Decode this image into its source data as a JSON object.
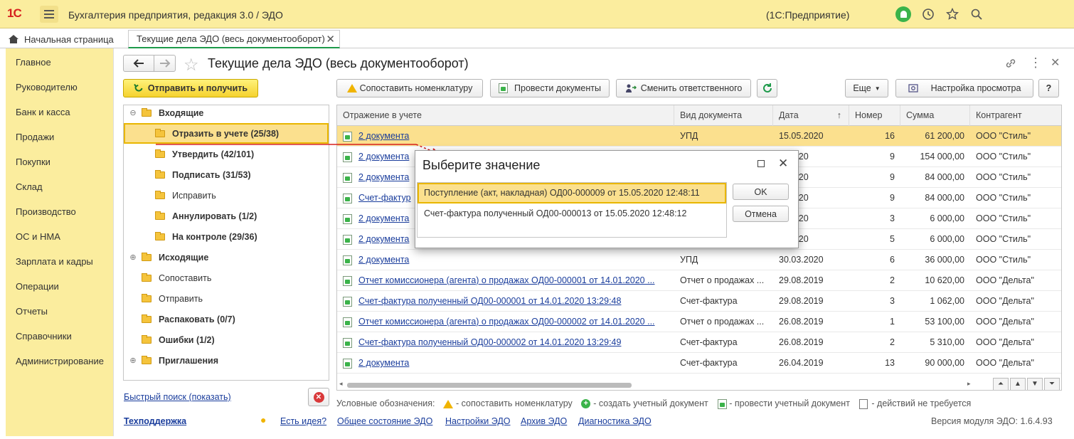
{
  "app": {
    "logo": "1С",
    "title": "Бухгалтерия предприятия, редакция 3.0 / ЭДО",
    "platform": "(1С:Предприятие)"
  },
  "tabs": {
    "home": "Начальная страница",
    "active": "Текущие дела ЭДО (весь документооборот)"
  },
  "sections": [
    "Главное",
    "Руководителю",
    "Банк и касса",
    "Продажи",
    "Покупки",
    "Склад",
    "Производство",
    "ОС и НМА",
    "Зарплата и кадры",
    "Операции",
    "Отчеты",
    "Справочники",
    "Администрирование"
  ],
  "page": {
    "title": "Текущие дела ЭДО (весь документооборот)",
    "send_receive": "Отправить и получить",
    "toolbar": {
      "match_nomenclature": "Сопоставить номенклатуру",
      "post_documents": "Провести документы",
      "change_responsible": "Сменить ответственного",
      "more": "Еще",
      "view_settings": "Настройка просмотра",
      "help": "?"
    }
  },
  "tree": [
    {
      "label": "Входящие",
      "bold": true,
      "level": 0,
      "expander": "⊖"
    },
    {
      "label": "Отразить в учете (25/38)",
      "bold": true,
      "level": 1,
      "selected": true
    },
    {
      "label": "Утвердить (42/101)",
      "bold": true,
      "level": 1
    },
    {
      "label": "Подписать (31/53)",
      "bold": true,
      "level": 1
    },
    {
      "label": "Исправить",
      "bold": false,
      "level": 1
    },
    {
      "label": "Аннулировать (1/2)",
      "bold": true,
      "level": 1
    },
    {
      "label": "На контроле (29/36)",
      "bold": true,
      "level": 1
    },
    {
      "label": "Исходящие",
      "bold": true,
      "level": 0,
      "expander": "⊕"
    },
    {
      "label": "Сопоставить",
      "bold": false,
      "level": 0
    },
    {
      "label": "Отправить",
      "bold": false,
      "level": 0
    },
    {
      "label": "Распаковать (0/7)",
      "bold": true,
      "level": 0
    },
    {
      "label": "Ошибки (1/2)",
      "bold": true,
      "level": 0
    },
    {
      "label": "Приглашения",
      "bold": true,
      "level": 0,
      "expander": "⊕"
    }
  ],
  "grid": {
    "columns": [
      "Отражение в учете",
      "Вид документа",
      "Дата",
      "Номер",
      "Сумма",
      "Контрагент"
    ],
    "sort_indicator": "↑",
    "rows": [
      {
        "doc": "2 документа",
        "type": "УПД",
        "date": "15.05.2020",
        "num": "16",
        "sum": "61 200,00",
        "partner": "ООО \"Стиль\"",
        "selected": true
      },
      {
        "doc": "2 документа",
        "type": "",
        "date": ".4.2020",
        "num": "9",
        "sum": "154 000,00",
        "partner": "ООО \"Стиль\""
      },
      {
        "doc": "2 документа",
        "type": "",
        "date": ".4.2020",
        "num": "9",
        "sum": "84 000,00",
        "partner": "ООО \"Стиль\""
      },
      {
        "doc": "Счет-фактур",
        "type": "",
        "date": ".4.2020",
        "num": "9",
        "sum": "84 000,00",
        "partner": "ООО \"Стиль\""
      },
      {
        "doc": "2 документа",
        "type": "",
        "date": ".3.2020",
        "num": "3",
        "sum": "6 000,00",
        "partner": "ООО \"Стиль\""
      },
      {
        "doc": "2 документа",
        "type": "",
        "date": ".3.2020",
        "num": "5",
        "sum": "6 000,00",
        "partner": "ООО \"Стиль\""
      },
      {
        "doc": "2 документа",
        "type": "УПД",
        "date": "30.03.2020",
        "num": "6",
        "sum": "36 000,00",
        "partner": "ООО \"Стиль\""
      },
      {
        "doc": "Отчет комиссионера (агента) о продажах ОД00-000001 от 14.01.2020 ...",
        "type": "Отчет о продажах ...",
        "date": "29.08.2019",
        "num": "2",
        "sum": "10 620,00",
        "partner": "ООО \"Дельта\""
      },
      {
        "doc": "Счет-фактура полученный ОД00-000001 от 14.01.2020 13:29:48",
        "type": "Счет-фактура",
        "date": "29.08.2019",
        "num": "3",
        "sum": "1 062,00",
        "partner": "ООО \"Дельта\""
      },
      {
        "doc": "Отчет комиссионера (агента) о продажах ОД00-000002 от 14.01.2020 ...",
        "type": "Отчет о продажах ...",
        "date": "26.08.2019",
        "num": "1",
        "sum": "53 100,00",
        "partner": "ООО \"Дельта\""
      },
      {
        "doc": "Счет-фактура полученный ОД00-000002 от 14.01.2020 13:29:49",
        "type": "Счет-фактура",
        "date": "26.08.2019",
        "num": "2",
        "sum": "5 310,00",
        "partner": "ООО \"Дельта\""
      },
      {
        "doc": "2 документа",
        "type": "Счет-фактура",
        "date": "26.04.2019",
        "num": "13",
        "sum": "90 000,00",
        "partner": "ООО \"Дельта\""
      }
    ]
  },
  "dialog": {
    "title": "Выберите значение",
    "options": [
      "Поступление (акт, накладная) ОД00-000009 от 15.05.2020 12:48:11",
      "Счет-фактура полученный ОД00-000013 от 15.05.2020 12:48:12"
    ],
    "ok": "OK",
    "cancel": "Отмена"
  },
  "footer": {
    "quick_search": "Быстрый поиск (показать)",
    "support": "Техподдержка",
    "idea": "Есть идея?",
    "legend_title": "Условные обозначения:",
    "legend_match": "- сопоставить номенклатуру",
    "legend_create": "- создать учетный документ",
    "legend_post": "- провести учетный документ",
    "legend_none": "- действий не требуется",
    "links": [
      "Общее состояние ЭДО",
      "Настройки ЭДО",
      "Архив ЭДО",
      "Диагностика ЭДО"
    ],
    "version": "Версия модуля ЭДО: 1.6.4.93"
  },
  "colors": {
    "accent_yellow": "#fbed9e",
    "selection": "#fbe08e",
    "link": "#1a3d9c",
    "green": "#3bb34a"
  }
}
